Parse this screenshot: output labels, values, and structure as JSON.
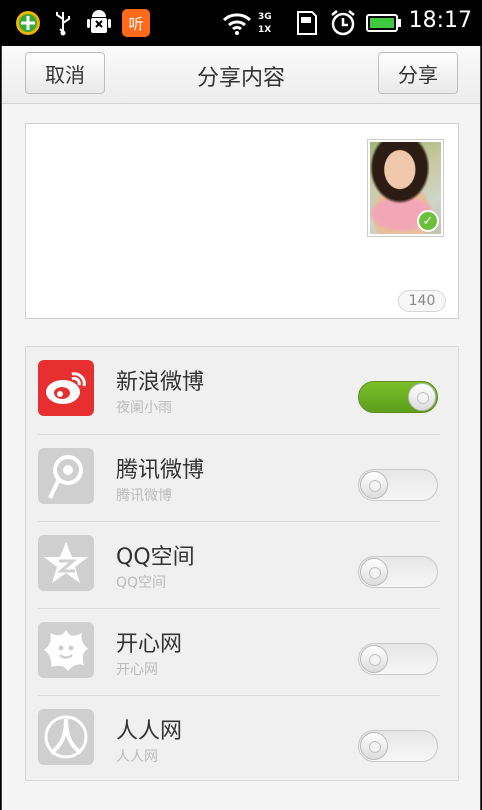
{
  "statusbar": {
    "icons": [
      "app-icon",
      "usb-icon",
      "android-debug-icon",
      "music-app-icon",
      "wifi-icon",
      "signal-icon",
      "sd-card-icon",
      "alarm-icon",
      "battery-icon"
    ],
    "network_label": "3G",
    "sim_label": "1X",
    "time": "18:17"
  },
  "header": {
    "cancel_label": "取消",
    "title": "分享内容",
    "share_label": "分享"
  },
  "compose": {
    "char_counter": "140",
    "attachment_icon": "photo-thumbnail",
    "attachment_selected": true
  },
  "platforms": [
    {
      "name": "新浪微博",
      "account": "夜阑小雨",
      "enabled": true,
      "icon": "sina-weibo-icon",
      "color": "#e6302f"
    },
    {
      "name": "腾讯微博",
      "account": "腾讯微博",
      "enabled": false,
      "icon": "tencent-weibo-icon",
      "color": "#cccccc"
    },
    {
      "name": "QQ空间",
      "account": "QQ空间",
      "enabled": false,
      "icon": "qzone-icon",
      "color": "#cccccc"
    },
    {
      "name": "开心网",
      "account": "开心网",
      "enabled": false,
      "icon": "kaixin-icon",
      "color": "#cccccc"
    },
    {
      "name": "人人网",
      "account": "人人网",
      "enabled": false,
      "icon": "renren-icon",
      "color": "#cccccc"
    }
  ],
  "colors": {
    "toggle_on": "#6cb127",
    "accent_check": "#6cbf3a"
  }
}
